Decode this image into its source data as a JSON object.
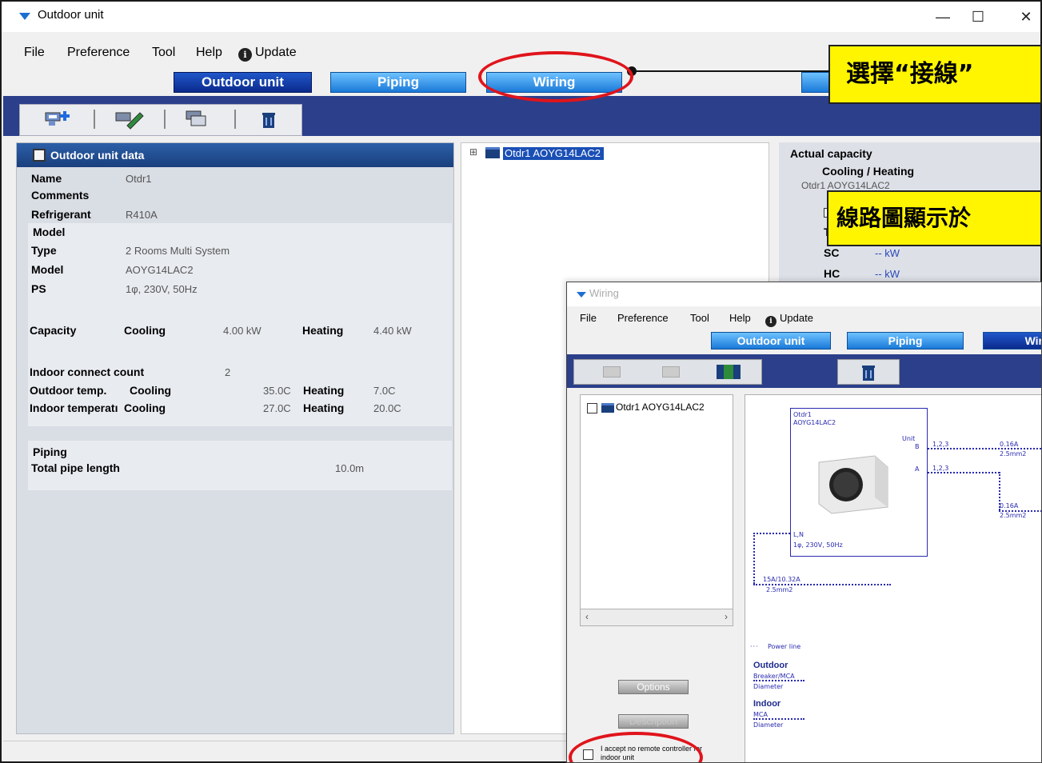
{
  "window": {
    "title": "Outdoor unit",
    "minimize": "—",
    "maximize": "☐",
    "close": "✕"
  },
  "menu": {
    "file": "File",
    "preference": "Preference",
    "tool": "Tool",
    "help": "Help",
    "update": "Update"
  },
  "tabs": {
    "outdoor": "Outdoor unit",
    "piping": "Piping",
    "wiring": "Wiring"
  },
  "callouts": {
    "select_wiring": "選擇“接線”",
    "diagram_shown": "線路圖顯示於"
  },
  "outdoor_data": {
    "header": "Outdoor unit data",
    "name_label": "Name",
    "name_value": "Otdr1",
    "comments_label": "Comments",
    "refrigerant_label": "Refrigerant",
    "refrigerant_value": "R410A",
    "model_section": "Model",
    "type_label": "Type",
    "type_value": "2 Rooms Multi System",
    "model_label": "Model",
    "model_value": "AOYG14LAC2",
    "ps_label": "PS",
    "ps_value": "1φ, 230V, 50Hz",
    "capacity_label": "Capacity",
    "cooling_label": "Cooling",
    "cooling_value": "4.00 kW",
    "heating_label": "Heating",
    "heating_value": "4.40 kW",
    "indoor_count_label": "Indoor connect count",
    "indoor_count_value": "2",
    "outdoor_temp_label": "Outdoor temp.",
    "outdoor_temp_cooling_label": "Cooling",
    "outdoor_temp_cooling": "35.0C",
    "outdoor_temp_heating_label": "Heating",
    "outdoor_temp_heating": "7.0C",
    "indoor_temp_label": "Indoor temperatı",
    "indoor_temp_cooling_label": "Cooling",
    "indoor_temp_cooling": "27.0C",
    "indoor_temp_heating_label": "Heating",
    "indoor_temp_heating": "20.0C",
    "piping_section": "Piping",
    "pipe_length_label": "Total pipe length",
    "pipe_length_value": "10.0m"
  },
  "tree": {
    "item": "Otdr1  AOYG14LAC2",
    "expander": "⊞"
  },
  "capacity": {
    "header": "Actual capacity",
    "subheader": "Cooling / Heating",
    "unit": "Otdr1  AOYG14LAC2",
    "t_label": "T",
    "sc_label": "SC",
    "sc_value": "--  kW",
    "hc_label": "HC",
    "hc_value": "--  kW"
  },
  "wiring": {
    "title": "Wiring",
    "menu": {
      "file": "File",
      "preference": "Preference",
      "tool": "Tool",
      "help": "Help",
      "update": "Update"
    },
    "tabs": {
      "outdoor": "Outdoor unit",
      "piping": "Piping",
      "wiring": "Wir"
    },
    "list_item": "Otdr1 AOYG14LAC2",
    "options_button": "Options",
    "second_button": "Description",
    "accept_text": "I accept no remote controller for indoor unit",
    "diagram": {
      "unit_name": "Otdr1",
      "unit_model": "AOYG14LAC2",
      "unit_label": "Unit",
      "port_b": "B",
      "port_a": "A",
      "line1_label": "1,2,3",
      "line1_amp": "0.16A",
      "line1_dia": "2.5mm2",
      "line2_label": "1,2,3",
      "line2_amp": "0.16A",
      "line2_dia": "2.5mm2",
      "power_terminal": "L,N",
      "power_spec": "1φ, 230V, 50Hz",
      "breaker": "15A/10.32A",
      "breaker_dia": "2.5mm2"
    },
    "legend": {
      "power_line": "Power line",
      "outdoor_title": "Outdoor",
      "outdoor_l1": "Breaker/MCA",
      "outdoor_l2": "Diameter",
      "indoor_title": "Indoor",
      "indoor_l1": "MCA",
      "indoor_l2": "Diameter"
    }
  },
  "colors": {
    "accent": "#1a79d8",
    "active_tab": "#0b2a8d",
    "band": "#2b3f8a",
    "callout": "#fff500",
    "ring": "#e0141b"
  }
}
